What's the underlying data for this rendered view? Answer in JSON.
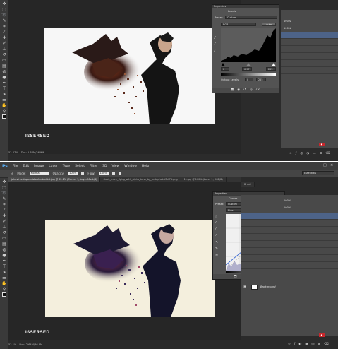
{
  "shot1": {
    "properties": {
      "title": "Properties",
      "panel_name": "Levels",
      "preset_label": "Preset:",
      "preset_value": "Custom",
      "channel_value": "RGB",
      "auto_label": "Auto",
      "input_values": [
        "0",
        "0.97",
        "255"
      ],
      "output_label": "Output Levels:",
      "output_values": [
        "0",
        "255"
      ]
    },
    "opacity_values": [
      "100%",
      "100%"
    ],
    "status": {
      "zoom": "52.67%",
      "doc": "Doc: 2.64M/36.9M"
    },
    "watermark": "ISSERSED"
  },
  "shot2": {
    "menu": [
      "File",
      "Edit",
      "Image",
      "Layer",
      "Type",
      "Select",
      "Filter",
      "3D",
      "View",
      "Window",
      "Help"
    ],
    "options": {
      "mode_label": "Mode:",
      "mode_value": "Normal",
      "opacity_label": "Opacity:",
      "opacity_value": "100%",
      "flow_label": "Flow:",
      "flow_value": "100%"
    },
    "workspace": "Essentials",
    "tabs": [
      "johnsfreestop-christopherbarbiel.jpg @ 52.1% (Curves 1, Layer Mask/8)",
      "stock_more_flying_with_alpha_layer_by_restaphot-d3ct7d.png",
      "11.jpg @ 100% (Layer 1, RGB/8)"
    ],
    "brush_tab": "Brush",
    "properties": {
      "title": "Properties",
      "panel_name": "Curves",
      "preset_label": "Preset:",
      "preset_value": "Custom",
      "channel_value": "Blue",
      "auto_label": "Auto"
    },
    "opacity_values": [
      "100%",
      "100%"
    ],
    "layer_name": "Background",
    "status": {
      "zoom": "52.1%",
      "doc": "Doc: 2.64M/36.9M"
    },
    "watermark": "ISSERSED"
  },
  "colors": {
    "ui_dark": "#2b2b2b",
    "panel": "#535353",
    "selection": "#4d6388",
    "ps_blue": "#5ab4ff",
    "red_tag": "#c8282d"
  },
  "icons": [
    "move-icon",
    "marquee-icon",
    "lasso-icon",
    "crop-icon",
    "eyedropper-icon",
    "brush-icon",
    "eraser-icon",
    "gradient-icon",
    "pen-icon",
    "type-icon",
    "hand-icon",
    "zoom-icon"
  ]
}
